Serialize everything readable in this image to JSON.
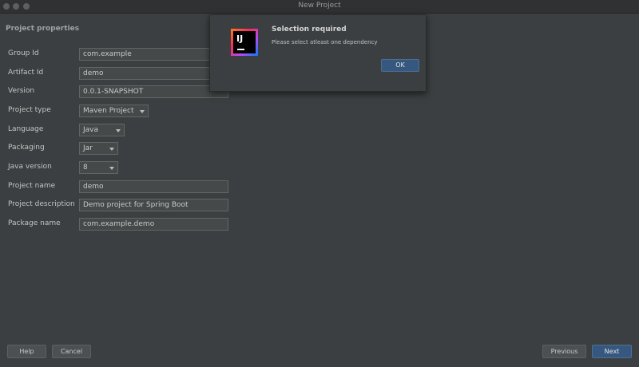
{
  "window": {
    "title": "New Project"
  },
  "section": {
    "title": "Project properties"
  },
  "form": {
    "group_id": {
      "label": "Group Id",
      "value": "com.example"
    },
    "artifact_id": {
      "label": "Artifact Id",
      "value": "demo"
    },
    "version": {
      "label": "Version",
      "value": "0.0.1-SNAPSHOT"
    },
    "project_type": {
      "label": "Project type",
      "value": "Maven Project"
    },
    "language": {
      "label": "Language",
      "value": "Java"
    },
    "packaging": {
      "label": "Packaging",
      "value": "Jar"
    },
    "java_version": {
      "label": "Java version",
      "value": "8"
    },
    "project_name": {
      "label": "Project name",
      "value": "demo"
    },
    "project_description": {
      "label": "Project description",
      "value": "Demo project for Spring Boot"
    },
    "package_name": {
      "label": "Package name",
      "value": "com.example.demo"
    }
  },
  "dialog": {
    "logo_text": "IJ",
    "title": "Selection required",
    "message": "Please select atleast one dependency",
    "ok_label": "OK"
  },
  "buttons": {
    "help": "Help",
    "cancel": "Cancel",
    "previous": "Previous",
    "next": "Next"
  },
  "colors": {
    "background": "#3c3f41",
    "field_bg": "#45494a",
    "primary_button": "#365880"
  }
}
